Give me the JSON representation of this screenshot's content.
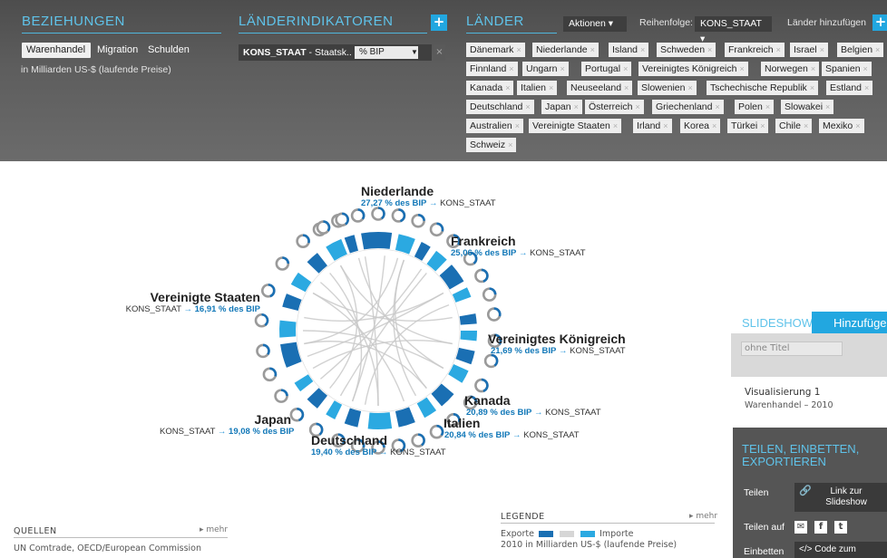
{
  "relations": {
    "title": "BEZIEHUNGEN",
    "tabs": [
      "Warenhandel",
      "Migration",
      "Schulden"
    ],
    "unit": "in Milliarden US-$ (laufende Preise)"
  },
  "indicators": {
    "title": "LÄNDERINDIKATOREN",
    "add": "+",
    "selected_code": "KONS_STAAT",
    "selected_rest": " - Staatsk...",
    "unit": "% BIP",
    "remove": "×"
  },
  "countries": {
    "title": "LÄNDER",
    "actions": "Aktionen ▾",
    "order_label": "Reihenfolge:",
    "order_value": "KONS_STAAT ▾",
    "add_label": "Länder hinzufügen",
    "add": "+",
    "chips": [
      "Dänemark",
      "Niederlande",
      "Island",
      "Schweden",
      "Frankreich",
      "Israel",
      "Belgien",
      "Finnland",
      "Ungarn",
      "Portugal",
      "Vereinigtes Königreich",
      "Norwegen",
      "Spanien",
      "Kanada",
      "Italien",
      "Neuseeland",
      "Slowenien",
      "Tschechische Republik",
      "Estland",
      "Deutschland",
      "Japan",
      "Österreich",
      "Griechenland",
      "Polen",
      "Slowakei",
      "Australien",
      "Vereinigte Staaten",
      "Irland",
      "Korea",
      "Türkei",
      "Chile",
      "Mexiko",
      "Schweiz"
    ]
  },
  "chart_labels": {
    "arrow": "→",
    "indicator": "KONS_STAAT",
    "niederlande": {
      "name": "Niederlande",
      "value": "27,27 % des BIP"
    },
    "frankreich": {
      "name": "Frankreich",
      "value": "25,06 % des BIP"
    },
    "vk": {
      "name": "Vereinigtes Königreich",
      "value": "21,69 % des BIP"
    },
    "kanada": {
      "name": "Kanada",
      "value": "20,89 % des BIP"
    },
    "italien": {
      "name": "Italien",
      "value": "20,84 % des BIP"
    },
    "deutschland": {
      "name": "Deutschland",
      "value": "19,40 % des BIP"
    },
    "japan": {
      "name": "Japan",
      "value": "19,08 % des BIP"
    },
    "usa": {
      "name": "Vereinigte Staaten",
      "value": "16,91 % des BIP"
    }
  },
  "sources": {
    "title": "QUELLEN",
    "more": "▸ mehr",
    "text": "UN Comtrade, OECD/European Commission"
  },
  "legend": {
    "title": "LEGENDE",
    "more": "▸ mehr",
    "exports": "Exporte",
    "imports": "Importe",
    "year_line": "2010  in Milliarden US-$ (laufende Preise)",
    "color_export_dark": "#1a6fb3",
    "color_import_light": "#2ba9e1"
  },
  "slideshow": {
    "title": "SLIDESHOW",
    "add": "Hinzufügen",
    "placeholder": "ohne Titel",
    "item_title": "Visualisierung 1",
    "item_sub": "Warenhandel – 2010"
  },
  "share": {
    "title": "TEILEN, EINBETTEN, EXPORTIEREN",
    "share_label": "Teilen",
    "link_btn": "Link zur Slideshow",
    "share_on": "Teilen auf",
    "embed_label": "Einbetten",
    "code_btn": "</> Code zum"
  },
  "colors": {
    "accent": "#22a7e0",
    "title_blue": "#5fc3ea",
    "panel": "#595959"
  }
}
